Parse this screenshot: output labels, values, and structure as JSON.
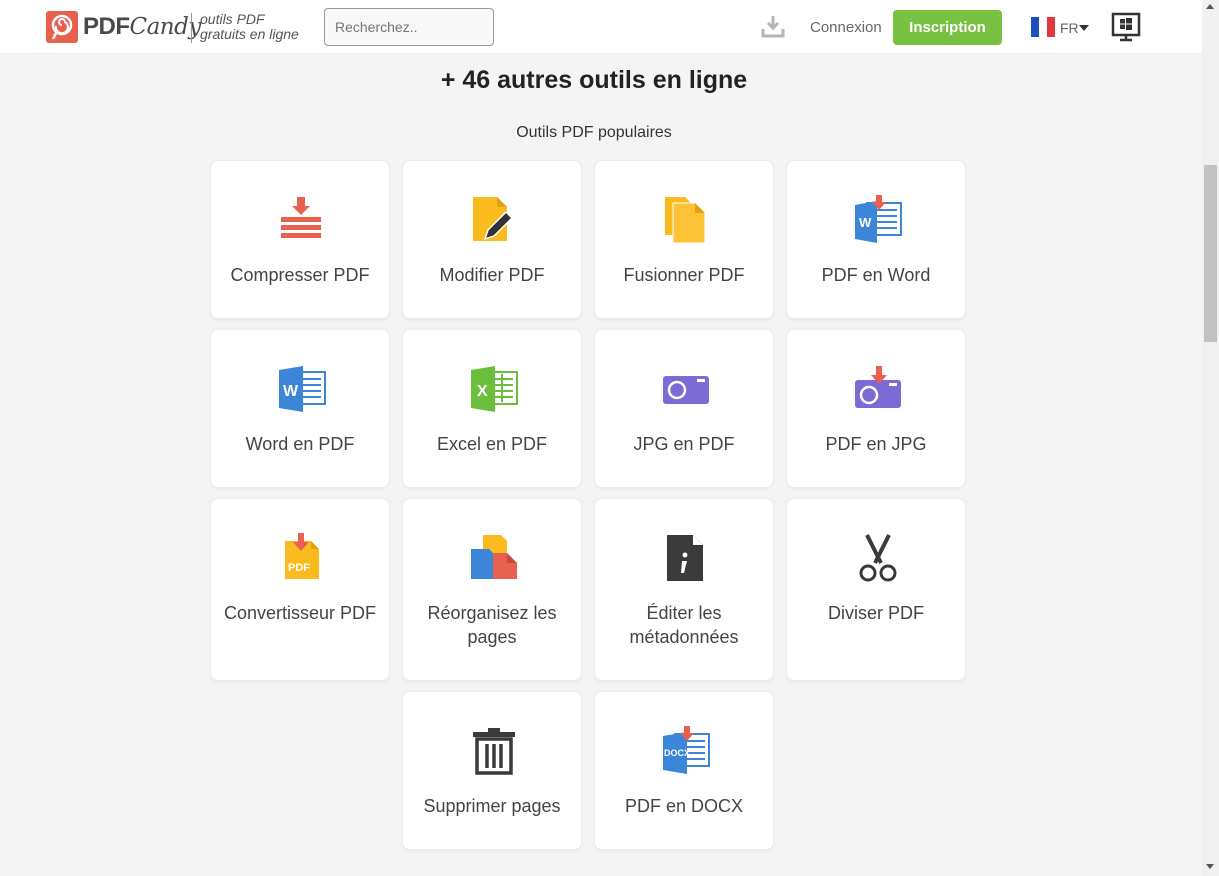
{
  "header": {
    "logo_text_pdf": "PDF",
    "logo_text_candy": "Candy",
    "tagline_line1": "outils PDF",
    "tagline_line2": "gratuits en ligne",
    "search_placeholder": "Recherchez..",
    "login_label": "Connexion",
    "signup_label": "Inscription",
    "language": "FR"
  },
  "main": {
    "heading": "+ 46 autres outils en ligne",
    "subheading": "Outils PDF populaires",
    "tools": [
      {
        "label": "Compresser PDF",
        "icon": "compress-icon"
      },
      {
        "label": "Modifier PDF",
        "icon": "edit-pdf-icon"
      },
      {
        "label": "Fusionner PDF",
        "icon": "merge-icon"
      },
      {
        "label": "PDF en Word",
        "icon": "pdf-to-word-icon"
      },
      {
        "label": "Word en PDF",
        "icon": "word-icon"
      },
      {
        "label": "Excel en PDF",
        "icon": "excel-icon"
      },
      {
        "label": "JPG en PDF",
        "icon": "camera-icon"
      },
      {
        "label": "PDF en JPG",
        "icon": "pdf-to-jpg-icon"
      },
      {
        "label": "Convertisseur PDF",
        "icon": "pdf-converter-icon"
      },
      {
        "label": "Réorganisez les pages",
        "icon": "reorder-pages-icon"
      },
      {
        "label": "Éditer les métadonnées",
        "icon": "metadata-icon"
      },
      {
        "label": "Diviser PDF",
        "icon": "scissors-icon"
      },
      {
        "label": "Supprimer pages",
        "icon": "trash-icon"
      },
      {
        "label": "PDF en DOCX",
        "icon": "pdf-to-docx-icon"
      }
    ]
  },
  "colors": {
    "accent_green": "#79c143",
    "brand_red": "#e8614e",
    "page_bg": "#f4f4f4"
  }
}
